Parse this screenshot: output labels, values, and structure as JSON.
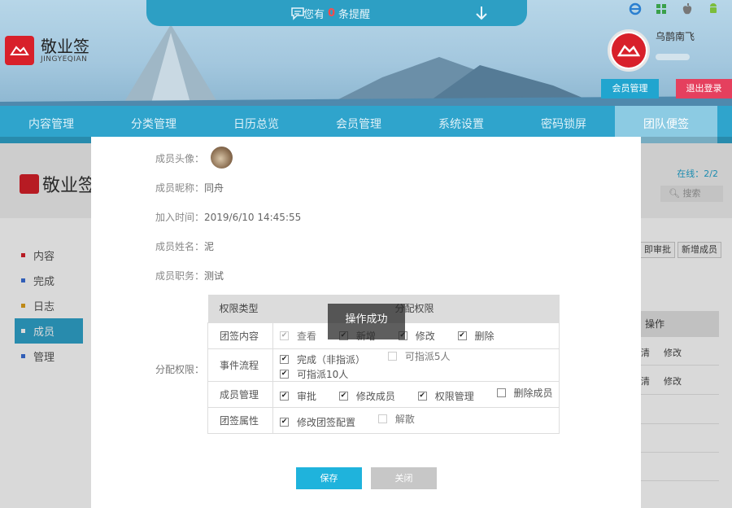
{
  "header": {
    "brand_name": "敬业签",
    "brand_sub": "JINGYEQIAN",
    "reminder_prefix": "您有",
    "reminder_count": "0",
    "reminder_suffix": "条提醒",
    "username": "乌鹊南飞",
    "member_button": "会员管理",
    "logout_button": "退出登录",
    "os_icons": [
      "ie-icon",
      "windows-icon",
      "apple-icon",
      "android-icon"
    ]
  },
  "nav": {
    "items": [
      "内容管理",
      "分类管理",
      "日历总览",
      "会员管理",
      "系统设置",
      "密码锁屏",
      "团队便签"
    ],
    "active_index": 6
  },
  "page": {
    "logo_text": "敬业签",
    "online_label": "在线：",
    "online_count": "2/2",
    "search_placeholder": "搜索",
    "sidebar": [
      {
        "label": "内容",
        "color": "#d8202a"
      },
      {
        "label": "完成",
        "color": "#3a6fd8"
      },
      {
        "label": "日志",
        "color": "#e0a21c"
      },
      {
        "label": "成员",
        "color": "#21a5cf"
      },
      {
        "label": "管理",
        "color": "#3a6fd8"
      }
    ],
    "action_buttons": [
      "即审批",
      "新增成员"
    ],
    "table_header": "操作",
    "row_actions": [
      [
        "清",
        "修改"
      ],
      [
        "清",
        "修改"
      ]
    ]
  },
  "modal": {
    "avatar_label": "成员头像：",
    "nickname_label": "成员昵称：",
    "nickname": "同舟",
    "join_label": "加入时间：",
    "join_time": "2019/6/10 14:45:55",
    "name_label": "成员姓名：",
    "name": "泥",
    "role_label": "成员职务：",
    "role": "测试",
    "perm_label": "分配权限：",
    "perm_header_type": "权限类型",
    "perm_header_assign": "分配权限",
    "perm_rows": [
      {
        "type": "团签内容",
        "options": [
          {
            "label": "查看",
            "checked": true,
            "dim": true
          },
          {
            "label": "新增",
            "checked": true,
            "dim": false
          },
          {
            "label": "修改",
            "checked": true,
            "dim": false
          },
          {
            "label": "删除",
            "checked": true,
            "dim": false
          }
        ]
      },
      {
        "type": "事件流程",
        "options": [
          {
            "label": "完成（非指派）",
            "checked": true,
            "dim": false
          },
          {
            "label": "可指派5人",
            "checked": false,
            "dim": true
          },
          {
            "label": "可指派10人",
            "checked": true,
            "dim": false
          }
        ]
      },
      {
        "type": "成员管理",
        "options": [
          {
            "label": "审批",
            "checked": true,
            "dim": false
          },
          {
            "label": "修改成员",
            "checked": true,
            "dim": false
          },
          {
            "label": "权限管理",
            "checked": true,
            "dim": false
          },
          {
            "label": "删除成员",
            "checked": false,
            "dim": false
          }
        ]
      },
      {
        "type": "团签属性",
        "options": [
          {
            "label": "修改团签配置",
            "checked": true,
            "dim": false
          },
          {
            "label": "解散",
            "checked": false,
            "dim": true
          }
        ]
      }
    ],
    "toast": "操作成功",
    "save_button": "保存",
    "close_button": "关闭"
  }
}
